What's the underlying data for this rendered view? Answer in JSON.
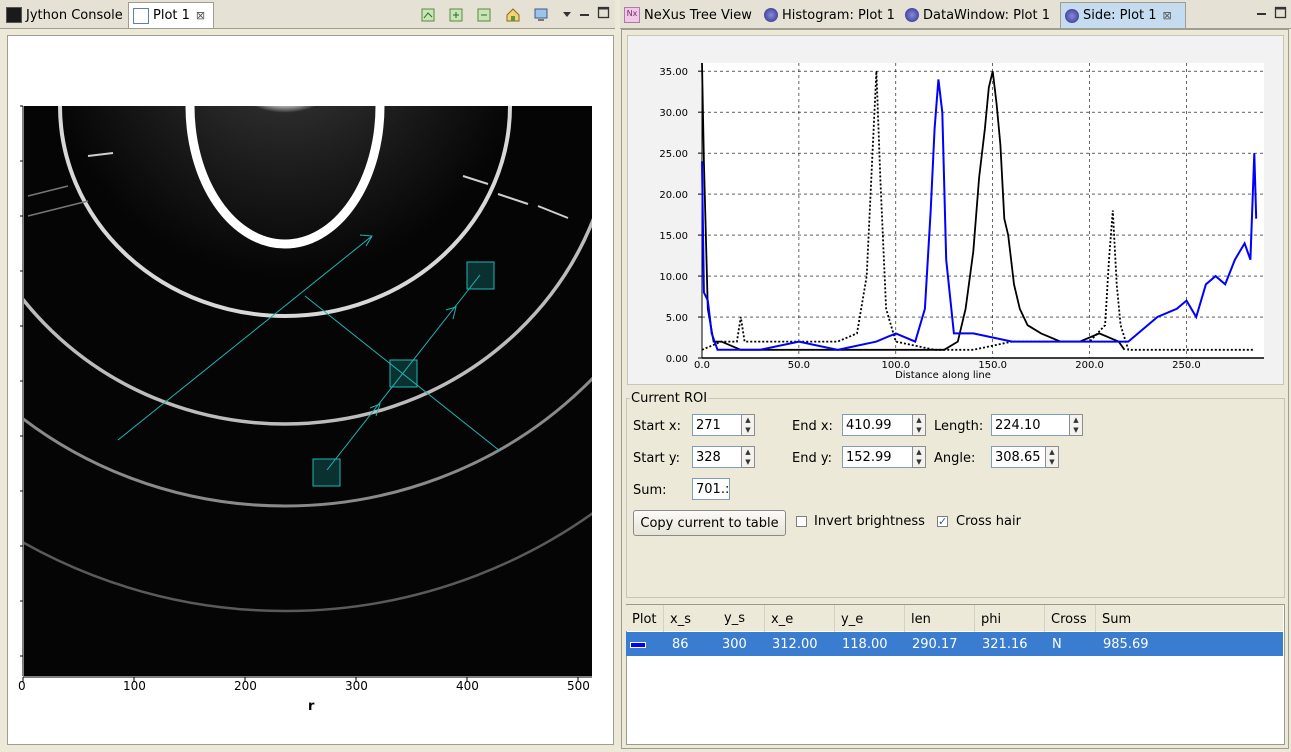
{
  "left_tabs": [
    {
      "label": "Jython Console",
      "icon": "console-icon"
    },
    {
      "label": "Plot 1",
      "icon": "plot-icon",
      "closable": true
    }
  ],
  "right_tabs": [
    {
      "label": "NeXus Tree View",
      "icon": "nexus-icon"
    },
    {
      "label": "Histogram: Plot 1",
      "icon": "view-icon"
    },
    {
      "label": "DataWindow: Plot 1",
      "icon": "view-icon"
    },
    {
      "label": "Side: Plot 1",
      "icon": "view-icon",
      "closable": true
    }
  ],
  "image_plot": {
    "x_ticks": [
      "0",
      "100",
      "200",
      "300",
      "400",
      "500"
    ],
    "xlabel": "r"
  },
  "roi": {
    "title": "Current ROI",
    "start_x_label": "Start x:",
    "start_x": "271",
    "start_y_label": "Start y:",
    "start_y": "328",
    "end_x_label": "End x:",
    "end_x": "410.99",
    "end_y_label": "End y:",
    "end_y": "152.99",
    "length_label": "Length:",
    "length": "224.10",
    "angle_label": "Angle:",
    "angle": "308.65",
    "sum_label": "Sum:",
    "sum": "701.:",
    "copy_button": "Copy current to table",
    "invert_label": "Invert brightness",
    "invert_checked": false,
    "crosshair_label": "Cross hair",
    "crosshair_checked": true
  },
  "table": {
    "headers": [
      "Plot",
      "x_s",
      "y_s",
      "x_e",
      "y_e",
      "len",
      "phi",
      "Cross",
      "Sum"
    ],
    "rows": [
      {
        "plot_color": "#0000ff",
        "x_s": "86",
        "y_s": "300",
        "x_e": "312.00",
        "y_e": "118.00",
        "len": "290.17",
        "phi": "321.16",
        "cross": "N",
        "sum": "985.69"
      }
    ]
  },
  "colors": {
    "selection": "#3a7ccf",
    "roi_cyan": "#1fb5b5",
    "series_blue": "#0000ff"
  },
  "chart_data": {
    "type": "line",
    "xlabel": "Distance along line",
    "ylabel": "",
    "xlim": [
      0,
      290
    ],
    "ylim": [
      0,
      36
    ],
    "x_ticks": [
      "0.0",
      "50.0",
      "100.0",
      "150.0",
      "200.0",
      "250.0"
    ],
    "y_ticks": [
      "0.00",
      "5.00",
      "10.00",
      "15.00",
      "20.00",
      "25.00",
      "30.00",
      "35.00"
    ],
    "grid": true,
    "series": [
      {
        "style": "solid",
        "color": "#000000",
        "x": [
          0,
          1,
          3,
          6,
          10,
          20,
          40,
          60,
          80,
          100,
          115,
          125,
          132,
          136,
          140,
          143,
          146,
          148,
          150,
          152,
          154,
          156,
          158,
          161,
          164,
          168,
          175,
          185,
          195,
          205,
          215,
          218
        ],
        "y": [
          36,
          24,
          6,
          2,
          2,
          1,
          1,
          1,
          1,
          1,
          1,
          1,
          2,
          6,
          13,
          22,
          28,
          33,
          35,
          31,
          26,
          17,
          15,
          9,
          6,
          4,
          3,
          2,
          2,
          3,
          2,
          1
        ]
      },
      {
        "style": "dotted",
        "color": "#000000",
        "x": [
          0,
          10,
          18,
          20,
          22,
          30,
          50,
          70,
          80,
          85,
          88,
          90,
          92,
          95,
          100,
          120,
          140,
          160,
          180,
          200,
          208,
          210,
          212,
          214,
          216,
          220,
          230,
          250,
          285
        ],
        "y": [
          1,
          2,
          2,
          5,
          2,
          2,
          2,
          2,
          3,
          10,
          25,
          35,
          22,
          6,
          2,
          1,
          1,
          2,
          2,
          2,
          4,
          12,
          18,
          9,
          4,
          1,
          1,
          1,
          1
        ]
      },
      {
        "style": "solid",
        "color": "#0000ff",
        "x": [
          0,
          1,
          3,
          5,
          8,
          15,
          30,
          50,
          70,
          90,
          100,
          110,
          115,
          118,
          120,
          122,
          124,
          126,
          130,
          140,
          160,
          180,
          200,
          220,
          235,
          245,
          250,
          255,
          260,
          265,
          270,
          275,
          280,
          283,
          285,
          286
        ],
        "y": [
          24,
          8,
          7,
          3,
          1,
          1,
          1,
          2,
          1,
          2,
          3,
          2,
          6,
          18,
          28,
          34,
          30,
          12,
          3,
          3,
          2,
          2,
          2,
          2,
          5,
          6,
          7,
          5,
          9,
          10,
          9,
          12,
          14,
          12,
          25,
          17
        ]
      }
    ]
  }
}
